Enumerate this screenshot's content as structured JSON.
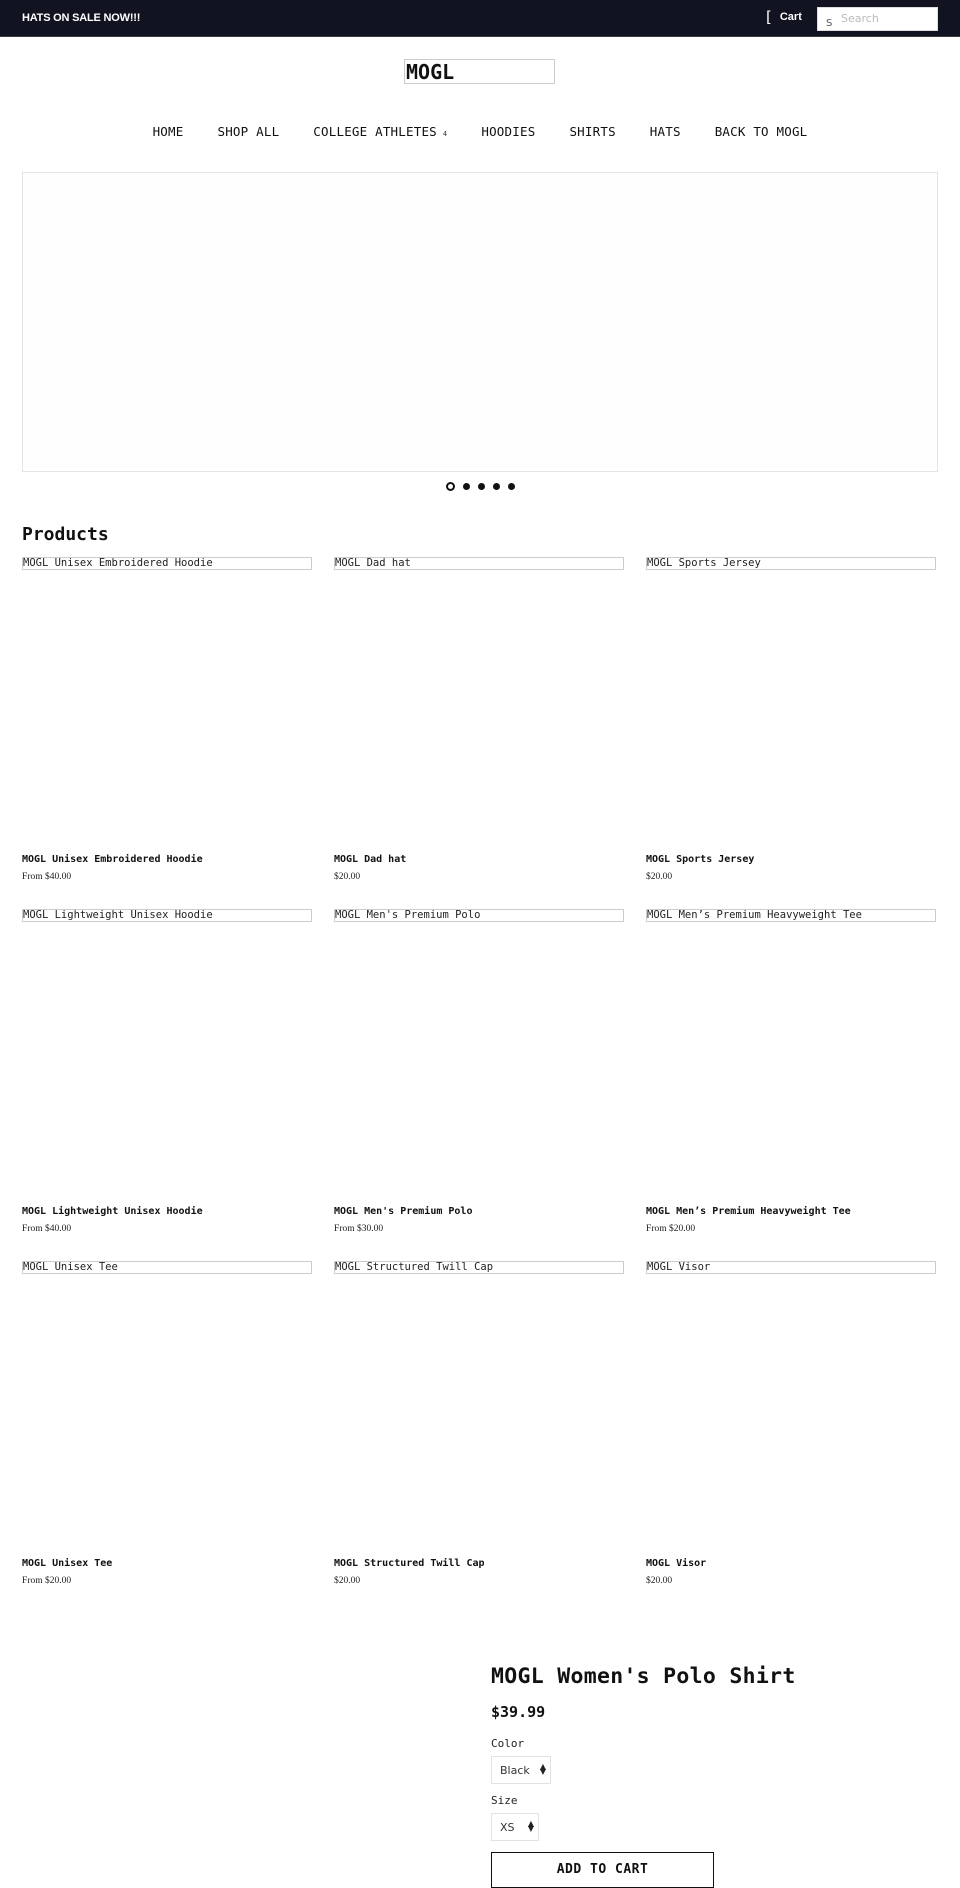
{
  "announcement": {
    "text": "HATS ON SALE NOW!!!"
  },
  "header": {
    "cart_icon": "[",
    "cart_label": "Cart",
    "search_icon": "S",
    "search_placeholder": "Search"
  },
  "logo": {
    "text": "MOGL"
  },
  "nav": {
    "items": [
      {
        "label": "HOME"
      },
      {
        "label": "SHOP ALL"
      },
      {
        "label": "COLLEGE ATHLETES",
        "dropdown_icon": "4"
      },
      {
        "label": "HOODIES"
      },
      {
        "label": "SHIRTS"
      },
      {
        "label": "HATS"
      },
      {
        "label": "BACK TO MOGL"
      }
    ]
  },
  "slideshow": {
    "slide_count": 5,
    "active_index": 0
  },
  "products": {
    "title": "Products",
    "items": [
      {
        "image_alt": "MOGL Unisex Embroidered Hoodie",
        "name": "MOGL Unisex Embroidered Hoodie",
        "price": "From $40.00"
      },
      {
        "image_alt": "MOGL Dad hat",
        "name": "MOGL Dad hat",
        "price": "$20.00"
      },
      {
        "image_alt": "MOGL Sports Jersey",
        "name": "MOGL Sports Jersey",
        "price": "$20.00"
      },
      {
        "image_alt": "MOGL Lightweight Unisex Hoodie",
        "name": "MOGL Lightweight Unisex Hoodie",
        "price": "From $40.00"
      },
      {
        "image_alt": "MOGL Men's Premium Polo",
        "name": "MOGL Men's Premium Polo",
        "price": "From $30.00"
      },
      {
        "image_alt": "MOGL Men’s Premium Heavyweight Tee",
        "name": "MOGL Men’s Premium Heavyweight Tee",
        "price": "From $20.00"
      },
      {
        "image_alt": "MOGL Unisex Tee",
        "name": "MOGL Unisex Tee",
        "price": "From $20.00"
      },
      {
        "image_alt": "MOGL Structured Twill Cap",
        "name": "MOGL Structured Twill Cap",
        "price": "$20.00"
      },
      {
        "image_alt": "MOGL Visor",
        "name": "MOGL Visor",
        "price": "$20.00"
      }
    ]
  },
  "featured_product": {
    "title": "MOGL Women's Polo Shirt",
    "price": "$39.99",
    "color_label": "Color",
    "color_value": "Black",
    "size_label": "Size",
    "size_value": "XS",
    "add_to_cart_label": "ADD TO CART"
  }
}
